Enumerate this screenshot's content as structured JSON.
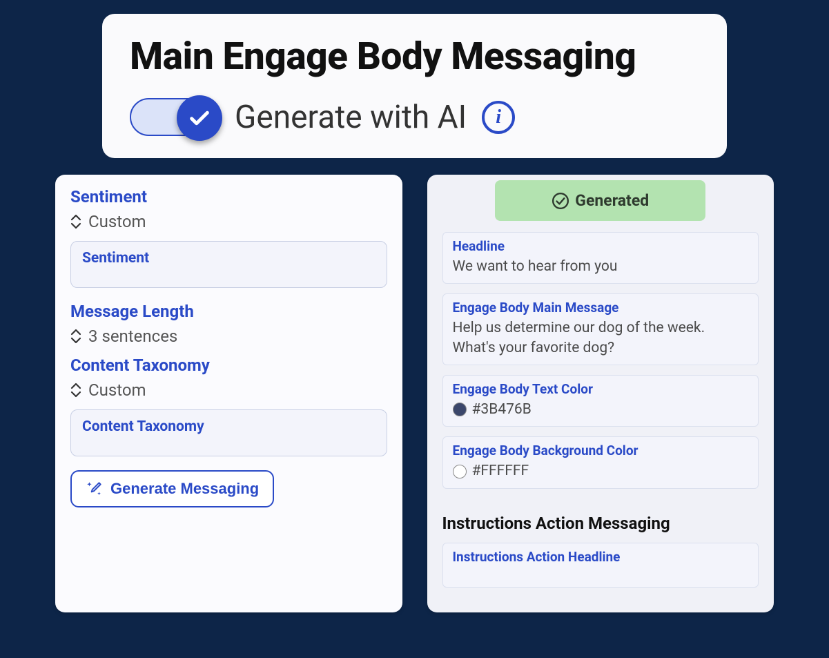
{
  "header": {
    "title": "Main Engage Body Messaging",
    "toggle_label": "Generate with AI",
    "toggle_on": true
  },
  "left": {
    "sentiment": {
      "label": "Sentiment",
      "value": "Custom",
      "input_label": "Sentiment"
    },
    "message_length": {
      "label": "Message Length",
      "value": "3 sentences"
    },
    "content_taxonomy": {
      "label": "Content Taxonomy",
      "value": "Custom",
      "input_label": "Content Taxonomy"
    },
    "generate_button": "Generate Messaging"
  },
  "right": {
    "generated_badge": "Generated",
    "headline": {
      "label": "Headline",
      "value": "We want to hear from you"
    },
    "main_message": {
      "label": "Engage Body Main Message",
      "value": "Help us determine our dog of the week. What's your favorite dog?"
    },
    "text_color": {
      "label": "Engage Body Text Color",
      "value": "#3B476B",
      "swatch": "#3B476B"
    },
    "bg_color": {
      "label": "Engage Body Background Color",
      "value": "#FFFFFF",
      "swatch": "#FFFFFF"
    },
    "instructions_section_title": "Instructions Action Messaging",
    "instructions_headline": {
      "label": "Instructions Action Headline"
    }
  }
}
